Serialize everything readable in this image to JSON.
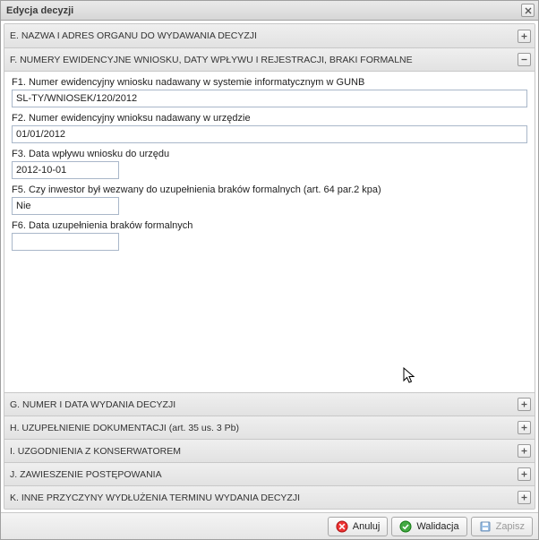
{
  "window": {
    "title": "Edycja decyzji"
  },
  "panels": {
    "e": {
      "title": "E. NAZWA I ADRES ORGANU DO WYDAWANIA DECYZJI"
    },
    "f": {
      "title": "F. NUMERY EWIDENCYJNE WNIOSKU, DATY WPŁYWU I REJESTRACJI, BRAKI FORMALNE"
    },
    "g": {
      "title": "G. NUMER I DATA WYDANIA DECYZJI"
    },
    "h": {
      "title": "H. UZUPEŁNIENIE DOKUMENTACJI (art. 35 us. 3 Pb)"
    },
    "i": {
      "title": "I. UZGODNIENIA Z KONSERWATOREM"
    },
    "j": {
      "title": "J. ZAWIESZENIE POSTĘPOWANIA"
    },
    "k": {
      "title": "K. INNE PRZYCZYNY WYDŁUŻENIA TERMINU WYDANIA DECYZJI"
    }
  },
  "fields": {
    "f1": {
      "label": "F1. Numer ewidencyjny wniosku nadawany w systemie informatycznym w GUNB",
      "value": "SL-TY/WNIOSEK/120/2012"
    },
    "f2": {
      "label": "F2. Numer ewidencyjny wnioksu nadawany w urzędzie",
      "value": "01/01/2012"
    },
    "f3": {
      "label": "F3. Data wpływu wniosku do urzędu",
      "value": "2012-10-01"
    },
    "f5": {
      "label": "F5. Czy inwestor był wezwany do uzupełnienia braków formalnych (art. 64 par.2 kpa)",
      "value": "Nie"
    },
    "f6": {
      "label": "F6. Data uzupełnienia braków formalnych",
      "value": ""
    }
  },
  "buttons": {
    "cancel": "Anuluj",
    "validate": "Walidacja",
    "save": "Zapisz"
  }
}
